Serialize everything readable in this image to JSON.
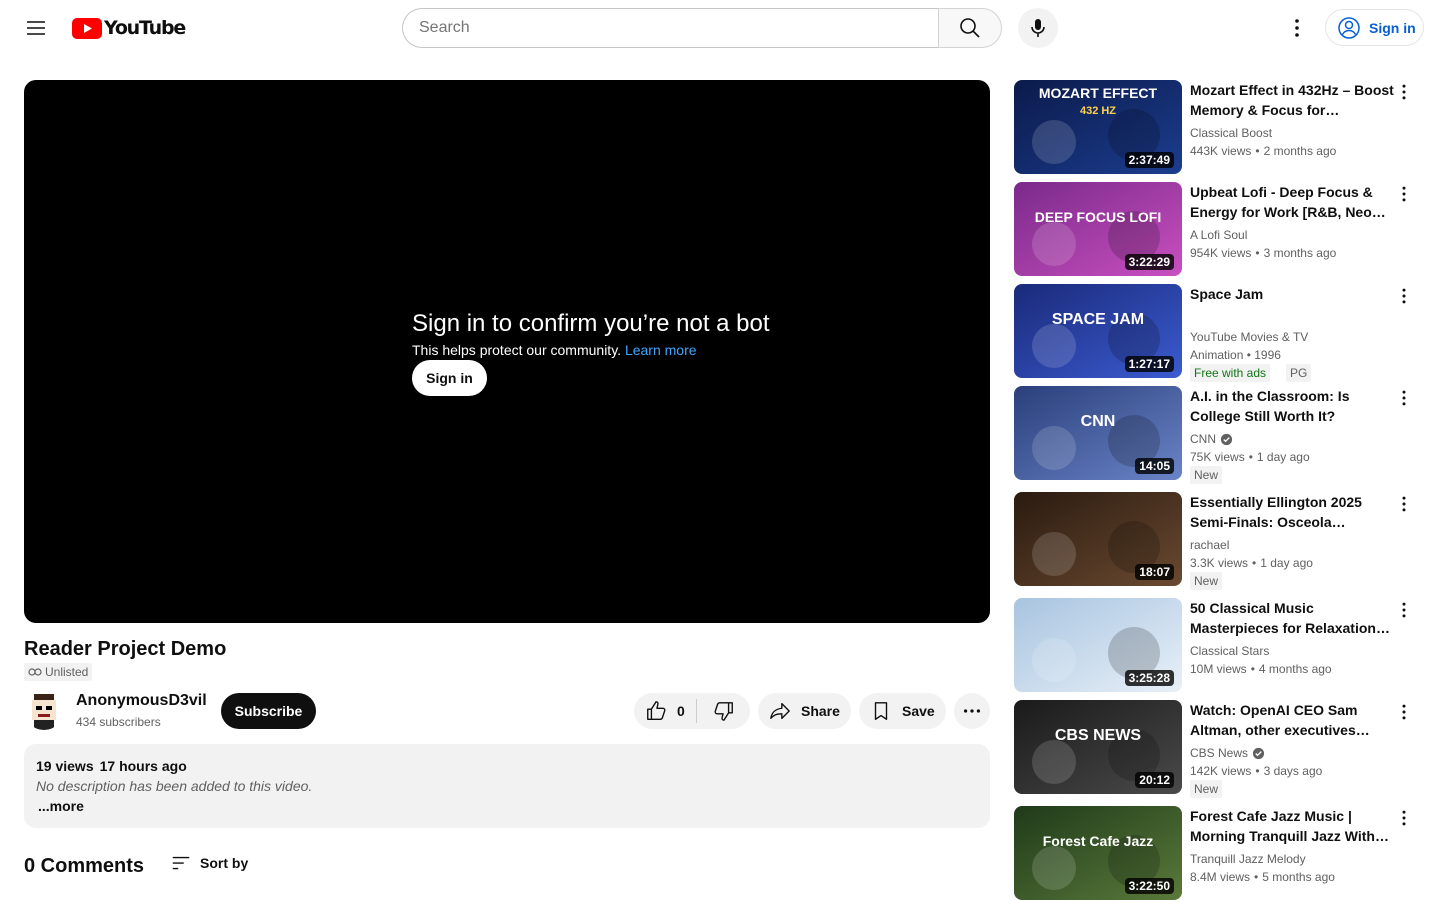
{
  "header": {
    "logo_text": "YouTube",
    "search_placeholder": "Search",
    "signin_label": "Sign in"
  },
  "player": {
    "bot_title": "Sign in to confirm you’re not a bot",
    "bot_desc": "This helps protect our community.",
    "learn_more": "Learn more",
    "signin_label": "Sign in"
  },
  "video": {
    "title": "Reader Project Demo",
    "visibility": "Unlisted",
    "channel": "AnonymousD3vil",
    "subscribers": "434 subscribers",
    "subscribe_label": "Subscribe",
    "likes": "0",
    "share_label": "Share",
    "save_label": "Save",
    "views": "19 views",
    "time": "17 hours ago",
    "description": "No description has been added to this video.",
    "more_label": "...more"
  },
  "comments": {
    "count_label": "0 Comments",
    "sort_label": "Sort by"
  },
  "recommendations": [
    {
      "title": "Mozart Effect in 432Hz – Boost Memory & Focus for Effective…",
      "channel": "Classical Boost",
      "views": "443K views",
      "age": "2 months ago",
      "duration": "2:37:49",
      "thumb_text": "MOZART EFFECT",
      "thumb_sub": "432 HZ",
      "colors": [
        "#0b1a4a",
        "#1c3d8f"
      ]
    },
    {
      "title": "Upbeat Lofi - Deep Focus & Energy for Work [R&B, Neo So…",
      "channel": "A Lofi Soul",
      "views": "954K views",
      "age": "3 months ago",
      "duration": "3:22:29",
      "thumb_text": "DEEP FOCUS LOFI",
      "colors": [
        "#7a2a8a",
        "#c94fc0"
      ]
    },
    {
      "title": "Space Jam",
      "channel": "YouTube Movies & TV",
      "extra": "Animation • 1996",
      "badge1": "Free with ads",
      "badge2": "PG",
      "duration": "1:27:17",
      "thumb_text": "SPACE JAM",
      "colors": [
        "#1a2a7a",
        "#3b5bd0"
      ]
    },
    {
      "title": "A.I. in the Classroom: Is College Still Worth It?",
      "channel": "CNN",
      "views": "75K views",
      "age": "1 day ago",
      "new_label": "New",
      "duration": "14:05",
      "thumb_text": "CNN",
      "colors": [
        "#2a3f7a",
        "#6a84c8"
      ]
    },
    {
      "title": "Essentially Ellington 2025 Semi-Finals: Osceola County…",
      "channel": "rachael",
      "views": "3.3K views",
      "age": "1 day ago",
      "new_label": "New",
      "duration": "18:07",
      "colors": [
        "#2a1a10",
        "#6a4a30"
      ]
    },
    {
      "title": "50 Classical Music Masterpieces for Relaxation &…",
      "channel": "Classical Stars",
      "views": "10M views",
      "age": "4 months ago",
      "duration": "3:25:28",
      "colors": [
        "#a8c4e0",
        "#e8f0f8"
      ]
    },
    {
      "title": "Watch: OpenAI CEO Sam Altman, other executives give…",
      "channel": "CBS News",
      "views": "142K views",
      "age": "3 days ago",
      "new_label": "New",
      "duration": "20:12",
      "thumb_text": "CBS NEWS",
      "colors": [
        "#1a1a1a",
        "#4a4a4a"
      ]
    },
    {
      "title": "Forest Cafe Jazz Music | Morning Tranquill Jazz With…",
      "channel": "Tranquill Jazz Melody",
      "views": "8.4M views",
      "age": "5 months ago",
      "duration": "3:22:50",
      "thumb_text": "Forest Cafe Jazz",
      "colors": [
        "#1f3a1a",
        "#5a7a3a"
      ]
    }
  ],
  "colors": {
    "brand_red": "#ff0000",
    "link_blue": "#065fd4",
    "learn_more_blue": "#3ea6ff",
    "free_green": "#107516"
  }
}
